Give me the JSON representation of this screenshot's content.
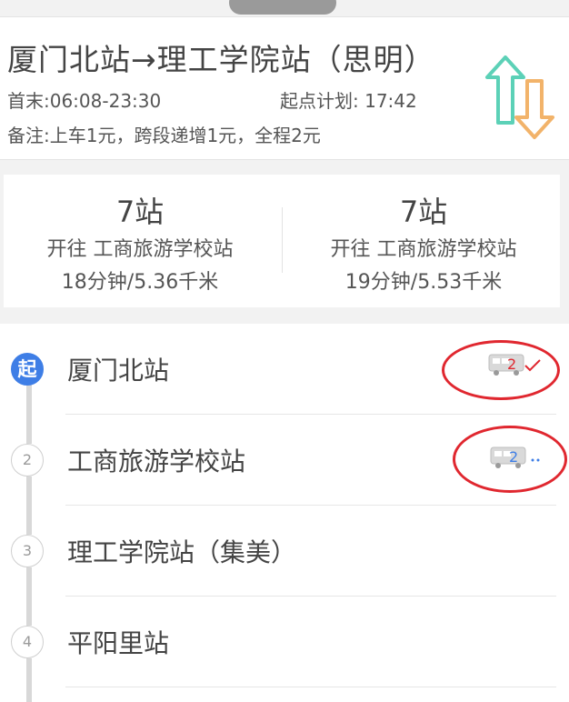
{
  "header": {
    "route_title": "厦门北站→理工学院站（思明）",
    "first_last": "首末:06:08-23:30",
    "plan": "起点计划: 17:42",
    "note": "备注:上车1元，跨段递增1元，全程2元",
    "switch_icon": "swap-direction-icon",
    "colors": {
      "up_arrow": "#5cd1b7",
      "down_arrow": "#f2b36a"
    }
  },
  "directions": [
    {
      "stops": "7站",
      "destination": "开往 工商旅游学校站",
      "time_distance": "18分钟/5.36千米"
    },
    {
      "stops": "7站",
      "destination": "开往 工商旅游学校站",
      "time_distance": "19分钟/5.53千米"
    }
  ],
  "stops": [
    {
      "badge": "起",
      "name": "厦门北站",
      "bus": "2",
      "bus_status": "arrived-check"
    },
    {
      "badge": "2",
      "name": "工商旅游学校站",
      "bus": "2",
      "bus_status": "approaching-dots"
    },
    {
      "badge": "3",
      "name": "理工学院站（集美）"
    },
    {
      "badge": "4",
      "name": "平阳里站"
    }
  ],
  "colors": {
    "accent": "#3e7ee6",
    "highlight": "#e0272f",
    "bus_number": "#e0272f",
    "bus_number_approaching": "#3e7ee6"
  }
}
